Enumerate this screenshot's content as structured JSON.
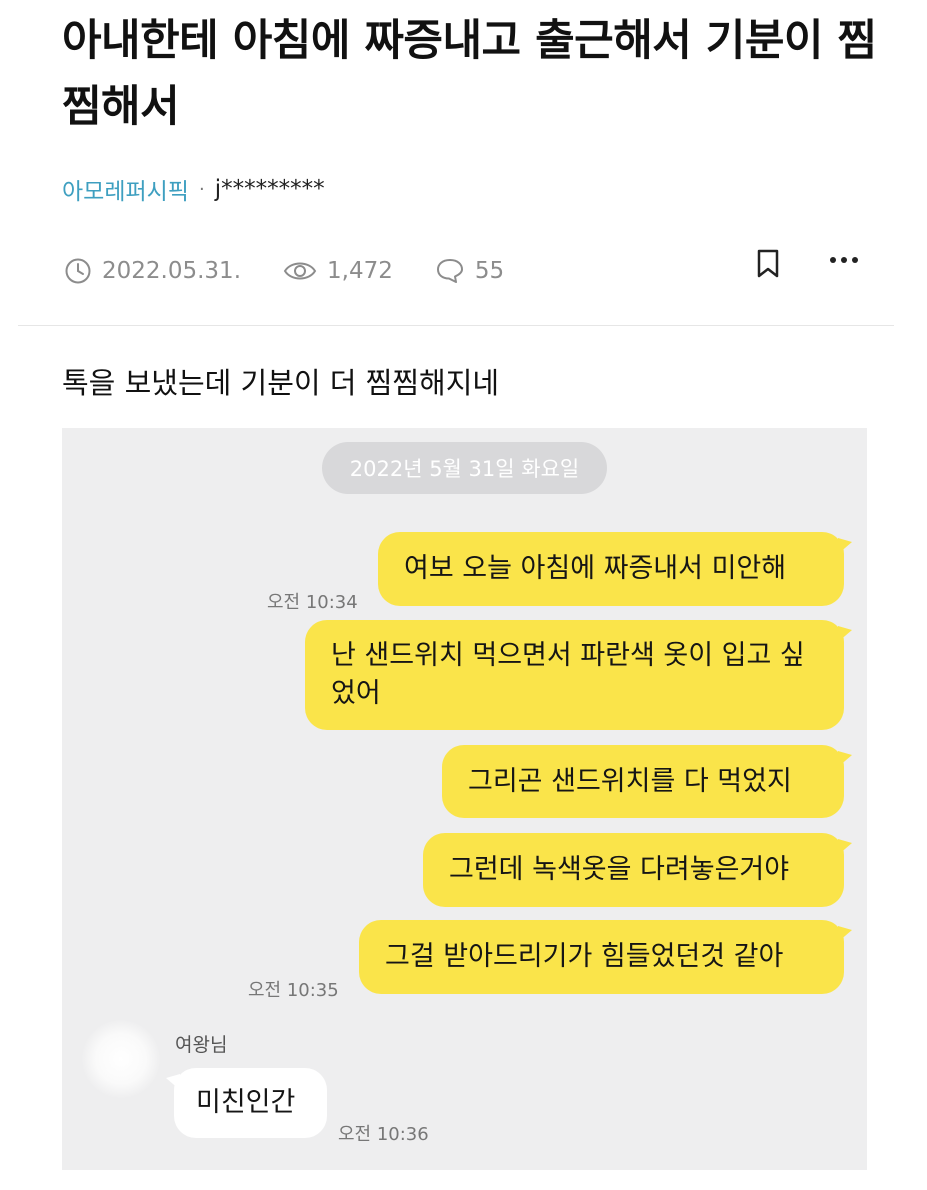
{
  "post": {
    "title": "아내한테 아침에 짜증내고 출근해서 기분이 찜찜해서",
    "board": "아모레퍼시픽",
    "separator": "·",
    "author": "j*********",
    "date": "2022.05.31.",
    "views": "1,472",
    "comments": "55",
    "body": "톡을 보냈는데 기분이 더 찜찜해지네"
  },
  "icons": {
    "date": "clock-icon",
    "views": "eye-icon",
    "comments": "speech-bubble-icon",
    "bookmark": "bookmark-icon",
    "more": "more-dots-icon"
  },
  "chat": {
    "date_label": "2022년 5월 31일 화요일",
    "messages": [
      {
        "text": "여보 오늘 아침에 짜증내서 미안해"
      },
      {
        "text": "난 샌드위치 먹으면서 파란색 옷이 입고 싶었어"
      },
      {
        "text": "그리곤 샌드위치를 다 먹었지"
      },
      {
        "text": "그런데 녹색옷을 다려놓은거야"
      },
      {
        "text": "그걸 받아드리기가 힘들었던것 같아"
      }
    ],
    "times": [
      "오전 10:34",
      "오전 10:35",
      "오전 10:36"
    ],
    "reply_sender": "여왕님",
    "reply_text": "미친인간"
  },
  "colors": {
    "board_link": "#3e9fc0",
    "bubble_yellow": "#fae44a",
    "chat_bg": "#eeeeef",
    "meta_gray": "#8c8c8c"
  }
}
